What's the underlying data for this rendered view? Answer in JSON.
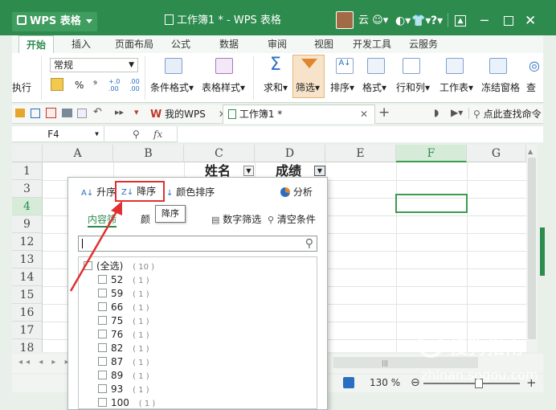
{
  "titlebar": {
    "app_name": "WPS 表格",
    "doc_title": "工作簿1 * - WPS 表格",
    "user_name": "云",
    "icons": [
      "shirt-icon",
      "help-icon",
      "minimize-icon",
      "restore-icon",
      "close-icon"
    ],
    "help_label": "?"
  },
  "menu": {
    "tabs": [
      {
        "label": "开始",
        "active": true
      },
      {
        "label": "插入"
      },
      {
        "label": "页面布局"
      },
      {
        "label": "公式"
      },
      {
        "label": "数据"
      },
      {
        "label": "审阅"
      },
      {
        "label": "视图"
      },
      {
        "label": "开发工具"
      },
      {
        "label": "云服务"
      }
    ]
  },
  "ribbon": {
    "number_format": "常规",
    "percent": "%",
    "comma": "⁹",
    "inc_decimal": ".00",
    "dec_decimal": ".00",
    "exec_label": "执行",
    "buttons": {
      "cond_format": "条件格式",
      "table_style": "表格样式",
      "sum": "求和",
      "filter": "筛选",
      "sort": "排序",
      "format": "格式",
      "rowcol": "行和列",
      "sheet": "工作表",
      "freeze": "冻结窗格",
      "find": "查"
    }
  },
  "tabbar": {
    "wps_tab": "我的WPS",
    "doc_tab": "工作簿1 *",
    "find_cmd": "点此查找命令"
  },
  "formula": {
    "cell_ref": "F4",
    "fx": "fx"
  },
  "grid": {
    "columns": [
      "A",
      "B",
      "C",
      "D",
      "E",
      "F",
      "G"
    ],
    "rows": [
      "1",
      "3",
      "4",
      "9",
      "12",
      "13",
      "14",
      "15",
      "16",
      "17",
      "18"
    ],
    "header_name": "姓名",
    "header_score": "成绩"
  },
  "dropdown": {
    "asc": "升序",
    "desc": "降序",
    "color_sort": "颜色排序",
    "analyze": "分析",
    "tooltip": "降序",
    "tab_content": "内容筛",
    "tab_color": "颜",
    "number_filter": "数字筛选",
    "clear_filter": "清空条件",
    "items": [
      {
        "label": "(全选)",
        "count": "( 10 )"
      },
      {
        "label": "52",
        "count": "( 1 )"
      },
      {
        "label": "59",
        "count": "( 1 )"
      },
      {
        "label": "66",
        "count": "( 1 )"
      },
      {
        "label": "75",
        "count": "( 1 )"
      },
      {
        "label": "76",
        "count": "( 1 )"
      },
      {
        "label": "82",
        "count": "( 1 )"
      },
      {
        "label": "87",
        "count": "( 1 )"
      },
      {
        "label": "89",
        "count": "( 1 )"
      },
      {
        "label": "93",
        "count": "( 1 )"
      },
      {
        "label": "100",
        "count": "( 1 )"
      }
    ]
  },
  "status": {
    "zoom": "130 %"
  },
  "watermark": {
    "site": "搜狗指南",
    "url": "zhinan.sogou.com"
  },
  "colors": {
    "title_green": "#2e8b4e",
    "highlight_red": "#e03030",
    "selection_green": "#3a9c4f"
  }
}
